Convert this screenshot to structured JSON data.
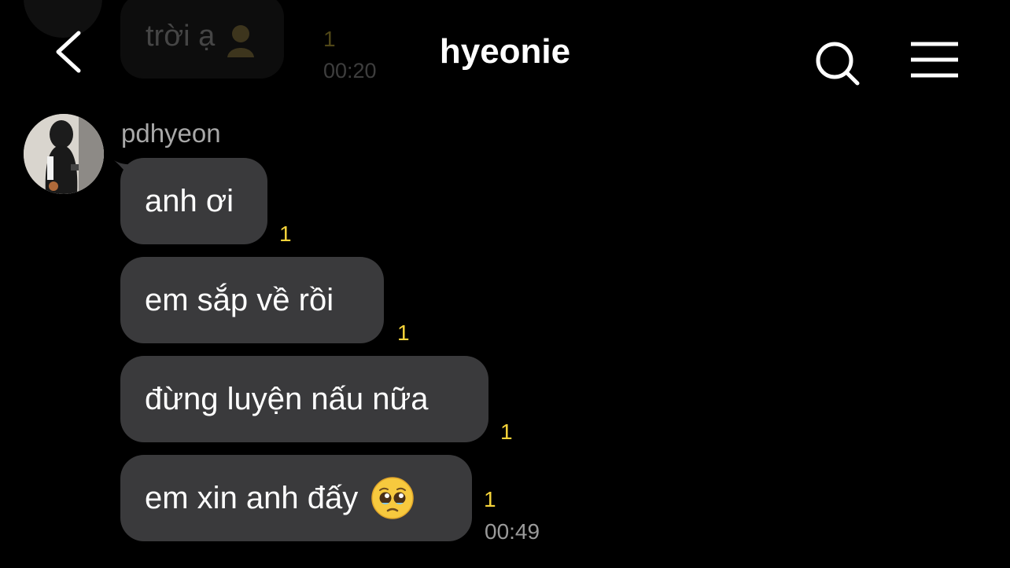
{
  "colors": {
    "background": "#000000",
    "bubble": "#3a3a3c",
    "text": "#ffffff",
    "unread": "#f5d33a",
    "muted": "#9a9a9a"
  },
  "header": {
    "title": "hyeonie",
    "back_icon": "chevron-left-icon",
    "search_icon": "search-icon",
    "menu_icon": "hamburger-menu-icon"
  },
  "previous_message": {
    "text": "trời ạ",
    "emoji_icon": "person-emoji-icon",
    "unread": "1",
    "time": "00:20"
  },
  "conversation": {
    "sender": "pdhyeon",
    "messages": [
      {
        "text": "anh ơi",
        "unread": "1"
      },
      {
        "text": "em sắp về rồi",
        "unread": "1"
      },
      {
        "text": "đừng luyện nấu nữa",
        "unread": "1"
      },
      {
        "text": "em xin anh đấy",
        "emoji_icon": "pleading-face-emoji-icon",
        "unread": "1",
        "time": "00:49"
      }
    ]
  }
}
